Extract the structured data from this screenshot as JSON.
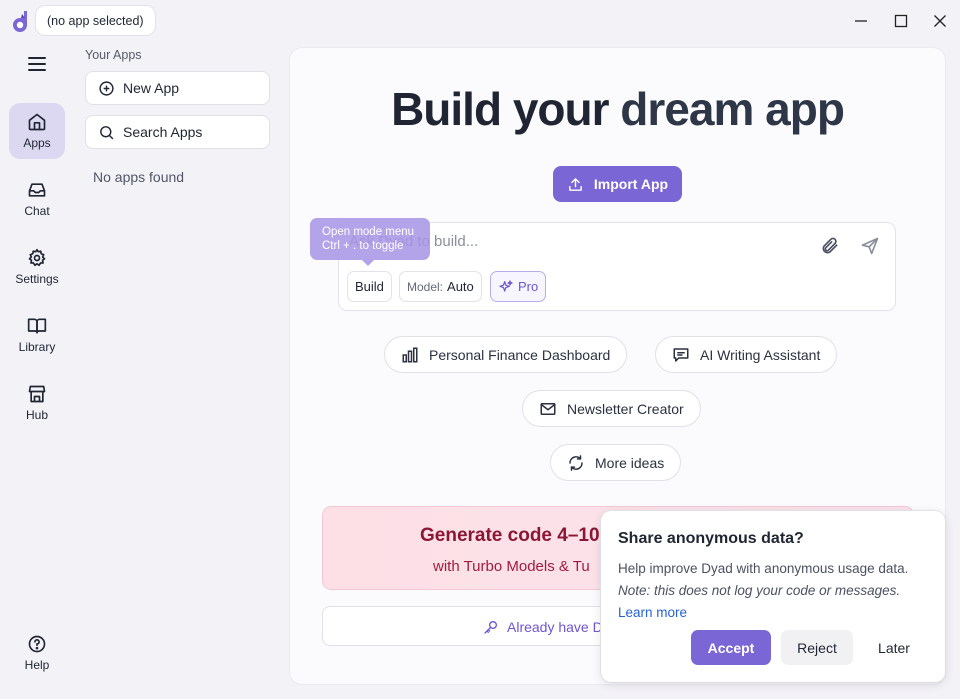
{
  "titlebar": {
    "app_selector": "(no app selected)"
  },
  "rail": {
    "items": [
      {
        "label": "Apps",
        "icon": "home-icon",
        "active": true
      },
      {
        "label": "Chat",
        "icon": "inbox-icon",
        "active": false
      },
      {
        "label": "Settings",
        "icon": "gear-icon",
        "active": false
      },
      {
        "label": "Library",
        "icon": "book-icon",
        "active": false
      },
      {
        "label": "Hub",
        "icon": "store-icon",
        "active": false
      }
    ],
    "help": {
      "label": "Help",
      "icon": "help-icon"
    }
  },
  "sidebar": {
    "heading": "Your Apps",
    "new_app": "New App",
    "search_apps": "Search Apps",
    "empty": "No apps found"
  },
  "main": {
    "hero_title_a": "Build your ",
    "hero_title_b": "dream app",
    "import_button": "Import App",
    "prompt_placeholder": "Ask Dyad to build...",
    "tooltip_line1": "Open mode menu",
    "tooltip_line2": "Ctrl + . to toggle",
    "mode_chip": "Build",
    "model_label": "Model:",
    "model_value": "Auto",
    "pro_chip": "Pro",
    "ideas": [
      {
        "label": "Personal Finance Dashboard",
        "icon": "bar-chart-icon"
      },
      {
        "label": "AI Writing Assistant",
        "icon": "message-icon"
      },
      {
        "label": "Newsletter Creator",
        "icon": "mail-icon"
      },
      {
        "label": "More ideas",
        "icon": "refresh-icon"
      }
    ],
    "promo_title": "Generate code 4–10",
    "promo_sub": "with Turbo Models & Tu",
    "key_text": "Already have D"
  },
  "consent": {
    "title": "Share anonymous data?",
    "body": "Help improve Dyad with anonymous usage data.",
    "note": "Note: this does not log your code or messages.",
    "link": "Learn more",
    "accept": "Accept",
    "reject": "Reject",
    "later": "Later"
  },
  "colors": {
    "accent": "#7b66d6",
    "rail_active": "#dcd8f2",
    "promo_text": "#8c1636"
  }
}
